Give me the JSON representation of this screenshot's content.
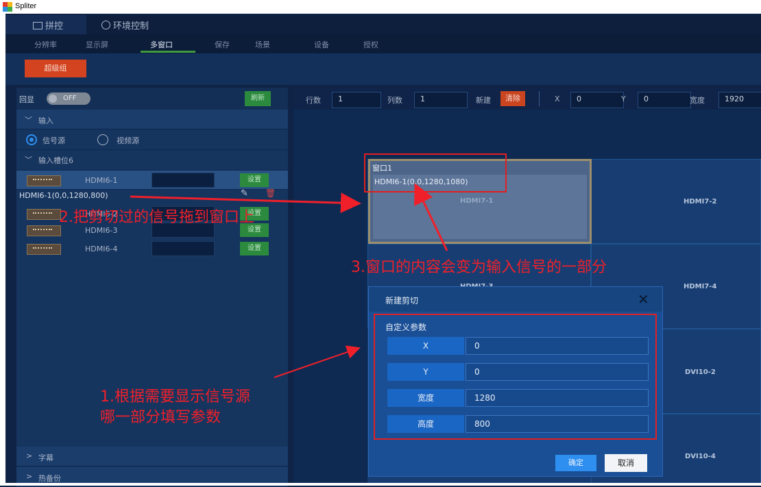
{
  "window": {
    "title": "Spliter"
  },
  "top_tabs": [
    {
      "label": "拼控",
      "icon": "tile-icon"
    },
    {
      "label": "环境控制",
      "icon": "gauge-icon"
    }
  ],
  "sub_nav": [
    "分辨率",
    "显示屏",
    "多窗口",
    "保存",
    "场景",
    "设备",
    "授权"
  ],
  "sub_nav_active": "多窗口",
  "super_group_button": "超级组",
  "left": {
    "echo_label": "回显",
    "echo_toggle": "OFF",
    "refresh_button": "刷新",
    "input_section": "输入",
    "radio_signal": "信号源",
    "radio_video": "视频源",
    "slot_section": "输入槽位6",
    "sources": [
      {
        "label": "HDMI6-1",
        "button": "设置"
      },
      {
        "label": "HDMI6-2",
        "button": "设置"
      },
      {
        "label": "HDMI6-3",
        "button": "设置"
      },
      {
        "label": "HDMI6-4",
        "button": "设置"
      }
    ],
    "crop_item": "HDMI6-1(0,0,1280,800)",
    "subtitle_section": "字幕",
    "hotbackup_section": "热备份"
  },
  "toolbar": {
    "rows_label": "行数",
    "rows_value": "1",
    "cols_label": "列数",
    "cols_value": "1",
    "new_label": "新建",
    "clear_label": "清除",
    "x_label": "X",
    "x_value": "0",
    "y_label": "Y",
    "y_value": "0",
    "width_label": "宽度",
    "width_value": "1920"
  },
  "canvas": {
    "cells": [
      "HDMI7-1",
      "HDMI7-2",
      "HDMI7-3",
      "HDMI7-4",
      "DVI10-2",
      "DVI10-4"
    ],
    "window_title": "窗口1",
    "window_content": "HDMI6-1(0,0,1280,1080)"
  },
  "dialog": {
    "title": "新建剪切",
    "section": "自定义参数",
    "fields": [
      {
        "label": "X",
        "value": "0"
      },
      {
        "label": "Y",
        "value": "0"
      },
      {
        "label": "宽度",
        "value": "1280"
      },
      {
        "label": "高度",
        "value": "800"
      }
    ],
    "ok": "确定",
    "cancel": "取消"
  },
  "annotations": {
    "step1_line1": "1.根据需要显示信号源",
    "step1_line2": "哪一部分填写参数",
    "step2": "2.把剪切过的信号拖到窗口上",
    "step3": "3.窗口的内容会变为输入信号的一部分"
  },
  "colors": {
    "accent": "#d4431f",
    "green": "#2c8a3f",
    "annotation": "#f0202a"
  }
}
